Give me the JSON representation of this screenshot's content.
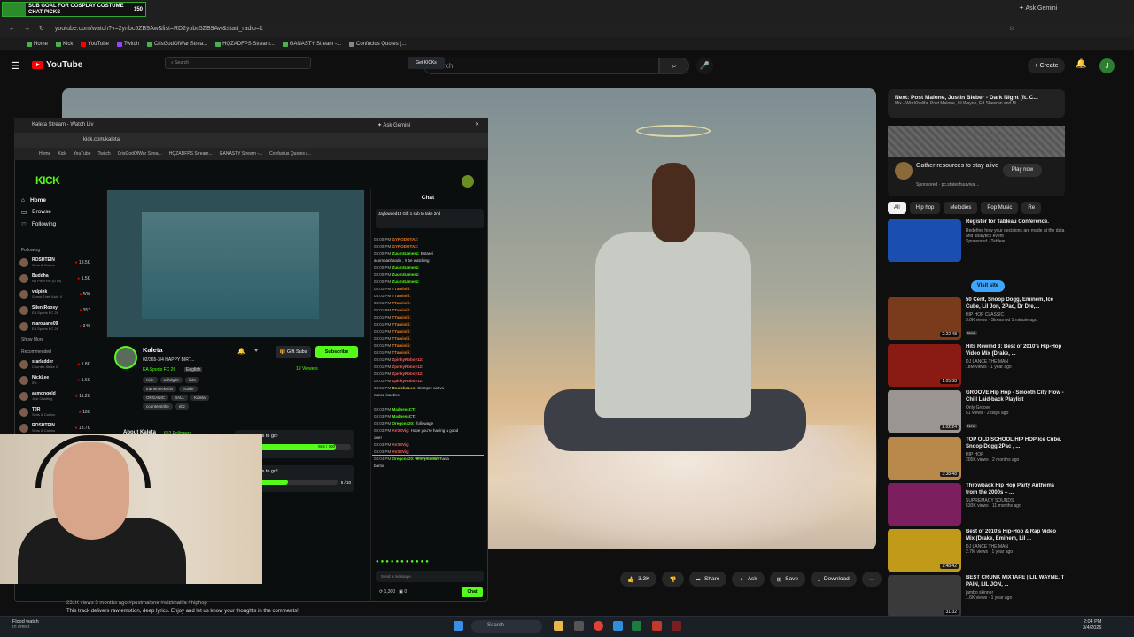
{
  "overlay": {
    "line1": "SUB GOAL FOR COSPLAY COSTUME",
    "line2": "CHAT PICKS",
    "count": "150"
  },
  "browser": {
    "url": "youtube.com/watch?v=2ynbc5ZB9Aw&list=RD2yobc5ZB9Aw&start_radio=1",
    "ask_gemini": "Ask Gemini",
    "bookmarks": [
      "Home",
      "Kick",
      "YouTube",
      "Twitch",
      "CrisGodOfWar Strea...",
      "HQZADFPS Stream...",
      "GANASTY Stream -...",
      "Confucius Quotes (..."
    ]
  },
  "youtube": {
    "logo": "YouTube",
    "search_placeholder": "Search",
    "create": "Create",
    "avatar": "J",
    "actions": {
      "likes": "3.3K",
      "share": "Share",
      "ask": "Ask",
      "save": "Save",
      "download": "Download"
    },
    "meta": "231K views  3 months ago  #postmalone #wizkhalifa #hiphop",
    "description": "This track delivers raw emotion, deep lyrics. Enjoy and let us know your thoughts in the comments!"
  },
  "kick": {
    "tab": "Kaleta Stream - Watch Liv",
    "ask_gemini": "Ask Gemini",
    "url": "kick.com/kaleta",
    "logo": "KICK",
    "search": "Search",
    "get_kicks": "Get KICKs",
    "nav": [
      "Home",
      "Browse",
      "Following"
    ],
    "following_label": "Following",
    "recommended_label": "Recommended",
    "show_more": "Show More",
    "following": [
      {
        "name": "ROSHTEIN",
        "game": "Slots & Casino",
        "viewers": "13.5K"
      },
      {
        "name": "Buddha",
        "game": "No Pixel RP (GTA)",
        "viewers": "1.5K"
      },
      {
        "name": "valpink",
        "game": "Grand Theft Auto V",
        "viewers": "500"
      },
      {
        "name": "SilentRoosy",
        "game": "EA Sports FC 26",
        "viewers": "357"
      },
      {
        "name": "marouane09",
        "game": "EA Sports FC 26",
        "viewers": "348"
      }
    ],
    "recommended": [
      {
        "name": "starladder",
        "game": "Counter-Strike 2",
        "viewers": "1.8K"
      },
      {
        "name": "NickLee",
        "game": "IRL",
        "viewers": "1.6K"
      },
      {
        "name": "asmongold",
        "game": "Just Chatting",
        "viewers": "11.2K"
      },
      {
        "name": "TJR",
        "game": "Slots & Casino",
        "viewers": "18K"
      },
      {
        "name": "ROSHTEIN",
        "game": "Slots & Casino",
        "viewers": "13.7K"
      }
    ],
    "streamer": "Kaleta",
    "title": "02/365-3/4 HAPPY BIRT...",
    "category": "EA Sports FC 26",
    "language": "English",
    "tags": [
      "Kick",
      "adhdgds",
      "kids",
      "trainemecksthv",
      "ecdde",
      "ORGANIC",
      "BALL",
      "Kaleta",
      "counterstrike",
      "ebz"
    ],
    "gift_subs": "Gift Subs",
    "subscribe": "Subscribe",
    "viewers": "19 Viewers",
    "about": "About Kaleta",
    "followers": "653 Followers",
    "goal1_title": "46 followers to go!",
    "goal1_progress": "604 / 700",
    "goal2_title": "ubscriptions to go!",
    "goal2_progress": "5 / 10",
    "chat_title": "Chat",
    "pinned": "Jaylowded13  Gift 1 sub to take 2nd",
    "new_messages": "New messages",
    "send_placeholder": "Send a message",
    "points": "1,300",
    "points2": "0",
    "chat_btn": "Chat",
    "chat": [
      {
        "t": "03:00 PM",
        "u": "GYRODOTA2:",
        "m": "",
        "c": ""
      },
      {
        "t": "03:00 PM",
        "u": "GYRODOTA2:",
        "m": "",
        "c": ""
      },
      {
        "t": "03:00 PM",
        "u": "ZuumGamesz:",
        "m": "Estarei",
        "c": "g"
      },
      {
        "t": "",
        "u": "",
        "m": "acompanhando , !! be watching",
        "c": ""
      },
      {
        "t": "03:00 PM",
        "u": "ZuumGamesz:",
        "m": "",
        "c": "g"
      },
      {
        "t": "03:00 PM",
        "u": "ZuumGamesz:",
        "m": "",
        "c": "g"
      },
      {
        "t": "03:00 PM",
        "u": "ZuumGamesz:",
        "m": "",
        "c": "g"
      },
      {
        "t": "03:01 PM",
        "u": "TTaminiti:",
        "m": "",
        "c": ""
      },
      {
        "t": "03:01 PM",
        "u": "TTaminiti:",
        "m": "",
        "c": ""
      },
      {
        "t": "03:01 PM",
        "u": "TTaminiti:",
        "m": "",
        "c": ""
      },
      {
        "t": "03:01 PM",
        "u": "TTaminiti:",
        "m": "",
        "c": ""
      },
      {
        "t": "03:01 PM",
        "u": "TTaminiti:",
        "m": "",
        "c": ""
      },
      {
        "t": "03:01 PM",
        "u": "TTaminiti:",
        "m": "",
        "c": ""
      },
      {
        "t": "03:01 PM",
        "u": "TTaminiti:",
        "m": "",
        "c": ""
      },
      {
        "t": "03:01 PM",
        "u": "TTaminiti:",
        "m": "",
        "c": ""
      },
      {
        "t": "03:01 PM",
        "u": "TTaminiti:",
        "m": "",
        "c": ""
      },
      {
        "t": "03:01 PM",
        "u": "TTaminiti:",
        "m": "",
        "c": ""
      },
      {
        "t": "03:01 PM",
        "u": "ZpinkyRoboy12:",
        "m": "",
        "c": "r"
      },
      {
        "t": "03:01 PM",
        "u": "ZpinkyRoboy12:",
        "m": "",
        "c": "r"
      },
      {
        "t": "03:01 PM",
        "u": "ZpinkyRoboy12:",
        "m": "",
        "c": "r"
      },
      {
        "t": "03:01 PM",
        "u": "ZpinkyRoboy12:",
        "m": "",
        "c": "r"
      },
      {
        "t": "03:01 PM",
        "u": "BooieboLeo:",
        "m": "Siempre activo",
        "c": "y"
      },
      {
        "t": "",
        "u": "",
        "m": "nunca inactivo",
        "c": ""
      },
      {
        "t": "03:03 PM",
        "u": "MadnessCT:",
        "m": "",
        "c": "g"
      },
      {
        "t": "03:03 PM",
        "u": "MadnessCT:",
        "m": "",
        "c": "g"
      },
      {
        "t": "03:03 PM",
        "u": "Oregon420:",
        "m": "!followage",
        "c": "g"
      },
      {
        "t": "03:03 PM",
        "u": "AV3SVig:",
        "m": "Hope you're having a good",
        "c": "r"
      },
      {
        "t": "",
        "u": "",
        "m": "one!",
        "c": ""
      },
      {
        "t": "03:03 PM",
        "u": "AV3SVig:",
        "m": "",
        "c": "r"
      },
      {
        "t": "03:03 PM",
        "u": "AV3SVig:",
        "m": "",
        "c": "r"
      },
      {
        "t": "03:04 PM",
        "u": "Oregon420:",
        "m": "okm you dont hava",
        "c": "g"
      },
      {
        "t": "",
        "u": "",
        "m": "barrix",
        "c": ""
      }
    ]
  },
  "right": {
    "next_label": "Next: Post Malone, Justin Bieber - Dark Night (ft. C...",
    "next_sub": "Mix - Wiz Khalifa, Post Malone, Lil Wayne, Ed Sheeran and M...",
    "ad_title": "Gather resources to stay alive",
    "ad_sponsored": "Sponsored · pc.stateofsurvival...",
    "ad_play": "Play now",
    "chips": [
      "All",
      "Hip hop",
      "Melodies",
      "Pop Music",
      "Re"
    ],
    "visit_site": "Visit site",
    "recs": [
      {
        "title": "Register for Tableau Conference.",
        "channel": "Redefine how your decisions are made at the data and analytics event",
        "views": "Sponsored · Tableau",
        "dur": "",
        "badge": "",
        "color": "#1a4fb0"
      },
      {
        "title": "50 Cent, Snoop Dogg, Eminem, Ice Cube, Lil Jon, 2Pac, Dr Dre,...",
        "channel": "HIP HOP CLASSIC",
        "views": "3.8K views · Streamed 1 minute ago",
        "dur": "2:22:48",
        "badge": "New",
        "color": "#7a3a1c"
      },
      {
        "title": "Hits Rewind 3: Best of 2010's Hip-Hop Video Mix (Drake, ...",
        "channel": "DJ LANCE THE MAN",
        "views": "18M views · 1 year ago",
        "dur": "1:05:38",
        "badge": "",
        "color": "#8a1a14"
      },
      {
        "title": "GROOVE Hip Hop - Smooth City Flow - Chill Laid-back Playlist",
        "channel": "Only Groove",
        "views": "51 views · 2 days ago",
        "dur": "2:02:24",
        "badge": "New",
        "color": "#9a9590"
      },
      {
        "title": "TOP OLD SCHOOL HIP HOP Ice Cube, Snoop Dogg,2Pac , ...",
        "channel": "HIP HOP",
        "views": "205K views · 2 months ago",
        "dur": "3:38:48",
        "badge": "",
        "color": "#b8894a"
      },
      {
        "title": "Throwback Hip Hop Party Anthems from the 2000s – ...",
        "channel": "SUPREMACY SOUNDS",
        "views": "530K views · 11 months ago",
        "dur": "",
        "badge": "",
        "color": "#7b1f5e"
      },
      {
        "title": "Best of 2010's Hip-Hop & Rap Video Mix (Drake, Eminem, Lil ...",
        "channel": "DJ LANCE THE MAN",
        "views": "2.7M views · 1 year ago",
        "dur": "1:48:42",
        "badge": "",
        "color": "#c29a1a"
      },
      {
        "title": "BEST CRUNK MIXTAPE | LIL WAYNE, T PAIN, LIL JON, ...",
        "channel": "jambo skinner",
        "views": "1.6K views · 1 year ago",
        "dur": "31:32",
        "badge": "",
        "color": "#3a3a3a"
      }
    ]
  },
  "taskbar": {
    "weather": "Flood watch",
    "weather2": "In effect",
    "search": "Search",
    "time": "2:04 PM",
    "date": "3/4/2026"
  }
}
